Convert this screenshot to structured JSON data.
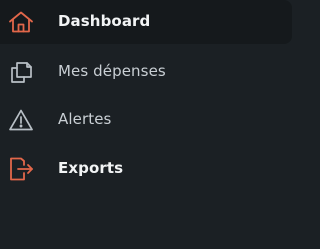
{
  "sidebar": {
    "items": [
      {
        "label": "Dashboard",
        "icon": "home-icon",
        "active": true
      },
      {
        "label": "Mes dépenses",
        "icon": "copy-icon",
        "active": false
      },
      {
        "label": "Alertes",
        "icon": "warning-icon",
        "active": false
      },
      {
        "label": "Exports",
        "icon": "export-icon",
        "active": false
      }
    ]
  },
  "colors": {
    "background": "#1b2024",
    "active_background": "#15191c",
    "accent": "#e2674a",
    "text_bright": "#f2f4f5",
    "text_muted": "#c9cfd4",
    "icon_muted": "#b9c0c6"
  }
}
